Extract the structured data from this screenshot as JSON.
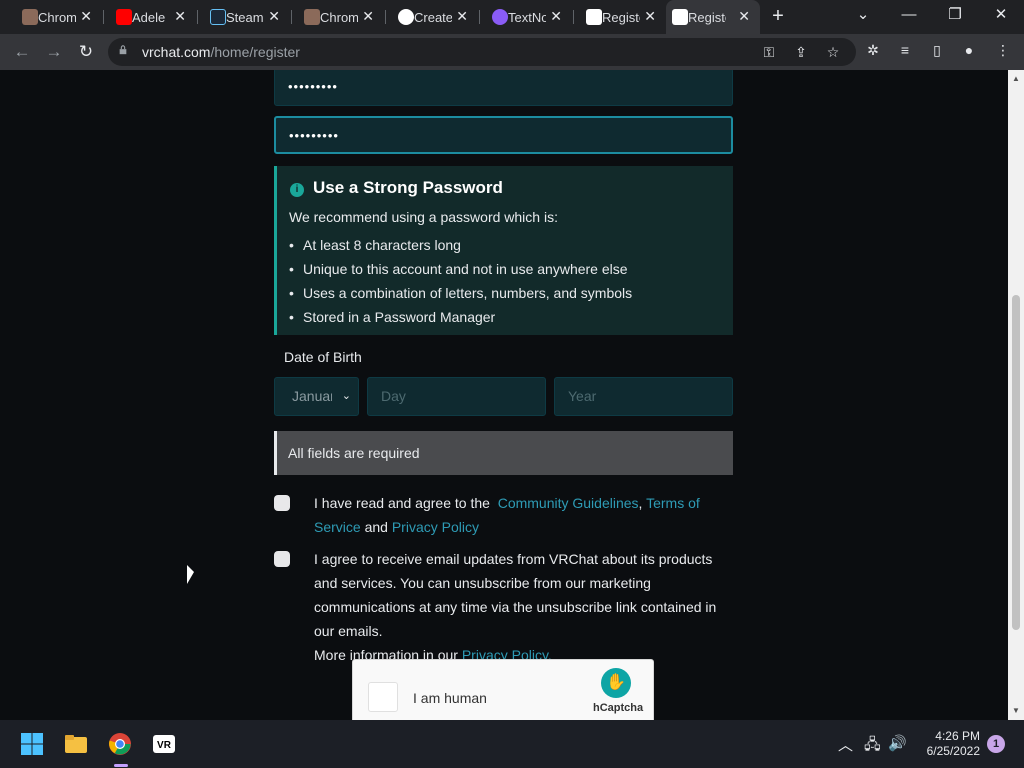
{
  "browser": {
    "tabs": [
      {
        "label": "Chrome",
        "color": "#8b6a5a"
      },
      {
        "label": "Adele",
        "color": "#ff0000"
      },
      {
        "label": "Steam",
        "color": "#1b2838"
      },
      {
        "label": "Chrome",
        "color": "#8b6a5a"
      },
      {
        "label": "Create",
        "color": "#ffffff"
      },
      {
        "label": "TextNow",
        "color": "#8a5cf5"
      },
      {
        "label": "Register",
        "color": "#ffffff"
      },
      {
        "label": "Register",
        "color": "#ffffff"
      }
    ],
    "url_domain": "vrchat.com",
    "url_path": "/home/register"
  },
  "form": {
    "password_value": "•••••••••",
    "password_confirm_value": "•••••••••",
    "notice": {
      "title": "Use a Strong Password",
      "intro": "We recommend using a password which is:",
      "bullets": [
        "At least 8 characters long",
        "Unique to this account and not in use anywhere else",
        "Uses a combination of letters, numbers, and symbols",
        "Stored in a Password Manager"
      ]
    },
    "dob_label": "Date of Birth",
    "month_value": "January",
    "day_placeholder": "Day",
    "year_placeholder": "Year",
    "required_msg": "All fields are required",
    "terms": {
      "prefix": "I have read and agree to the",
      "community": "Community Guidelines",
      "comma": ",",
      "tos": "Terms of Service",
      "and": "and",
      "privacy": "Privacy Policy"
    },
    "email_updates": {
      "text": "I agree to receive email updates from VRChat about its products and services. You can unsubscribe from our marketing communications at any time via the unsubscribe link contained in our emails.",
      "more": "More information in our",
      "privacy": "Privacy Policy."
    },
    "captcha": {
      "label": "I am human",
      "brand": "hCaptcha"
    }
  },
  "taskbar": {
    "time": "4:26 PM",
    "date": "6/25/2022",
    "notifications": "1"
  },
  "colors": {
    "accent": "#1aa79a",
    "link": "#2e9bb5"
  }
}
